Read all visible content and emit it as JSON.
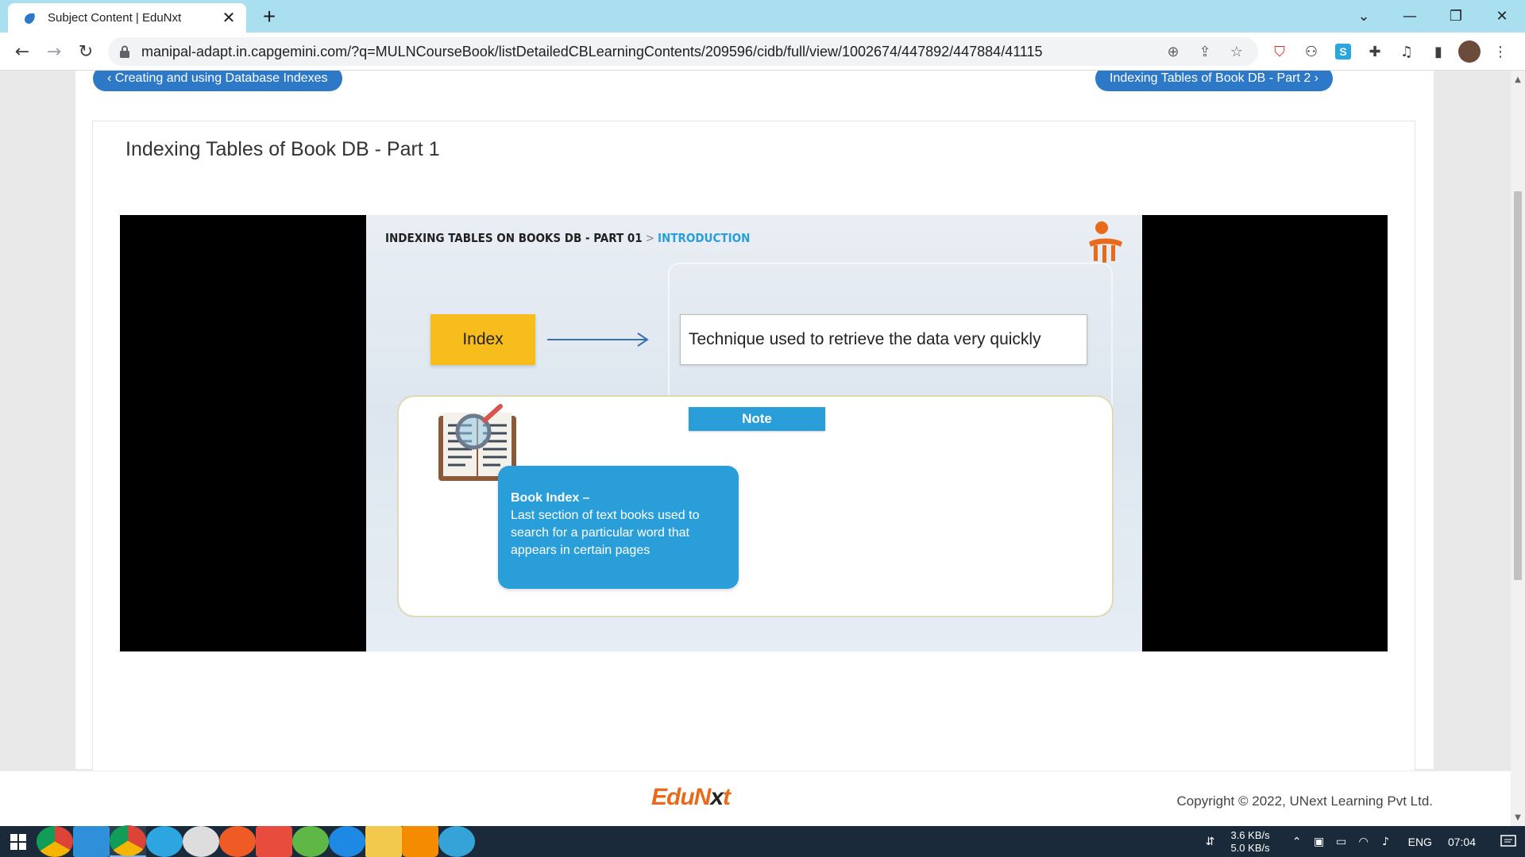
{
  "browser": {
    "tab_title": "Subject Content | EduNxt",
    "tab_close": "✕",
    "new_tab": "+",
    "url": "manipal-adapt.in.capgemini.com/?q=MULNCourseBook/listDetailedCBLearningContents/209596/cidb/full/view/1002674/447892/447884/41115"
  },
  "page": {
    "prev_label": "‹ Creating and using Database Indexes",
    "next_label": "Indexing Tables of Book DB - Part 2 ›",
    "content_title": "Indexing Tables of Book DB - Part 1"
  },
  "slide": {
    "heading": "INDEXING TABLES ON BOOKS DB - PART 01",
    "separator": ">",
    "section": "INTRODUCTION",
    "index_label": "Index",
    "definition": "Technique used to retrieve the data very quickly",
    "note_label": "Note",
    "bubble_title": "Book Index –",
    "bubble_text": "Last section of text books used to search for a particular word that appears in certain pages"
  },
  "footer": {
    "logo_edu": "Edu",
    "logo_n": "N",
    "logo_x": "x",
    "logo_t": "t",
    "copyright": "Copyright © 2022, UNext Learning Pvt Ltd."
  },
  "taskbar": {
    "net_up": "3.6 KB/s",
    "net_down": "5.0 KB/s",
    "lang": "ENG",
    "time": "07:04"
  },
  "colors": {
    "tab_strip": "#a9dfef",
    "nav_pill": "#2d79c7",
    "slide_accent": "#2a9ed8",
    "index_box": "#f7bd1c",
    "logo_orange": "#e86b1c"
  }
}
